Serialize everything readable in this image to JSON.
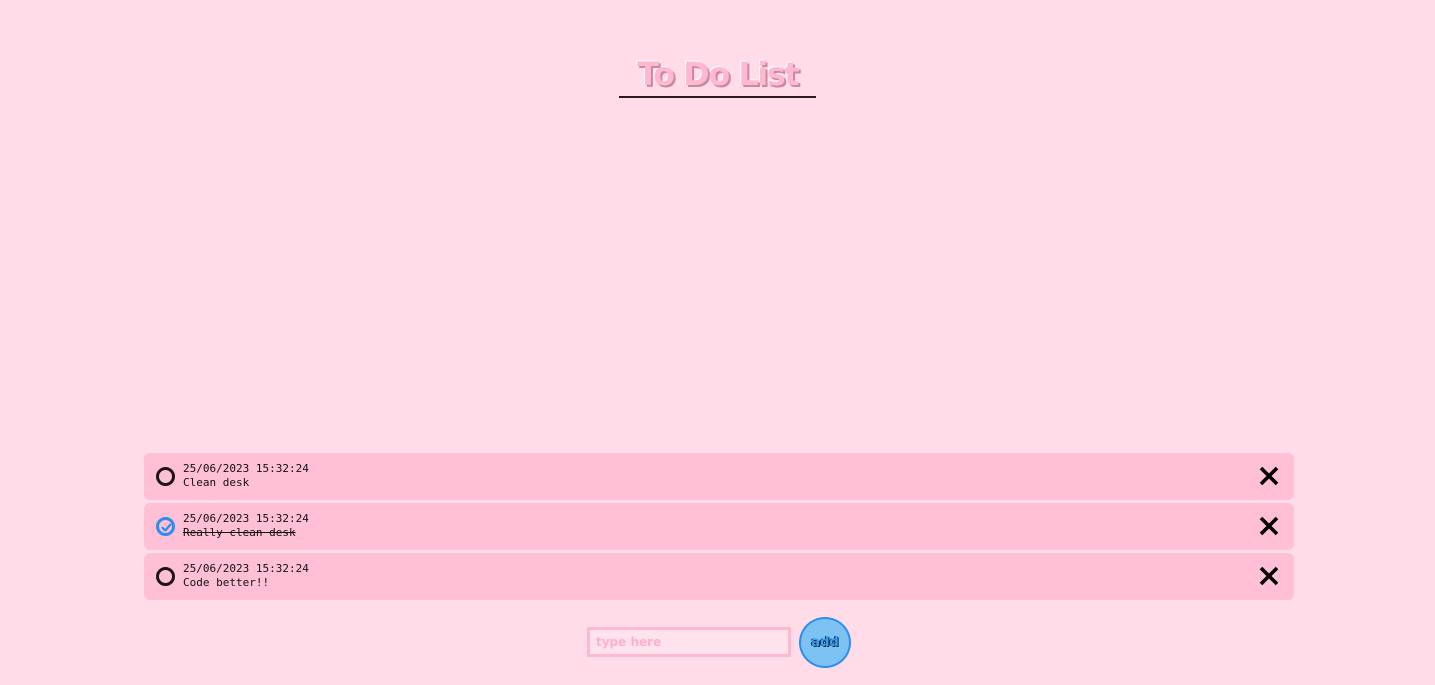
{
  "title": "To Do List",
  "items": [
    {
      "timestamp": "25/06/2023 15:32:24",
      "label": "Clean desk",
      "done": false
    },
    {
      "timestamp": "25/06/2023 15:32:24",
      "label": "Really clean desk",
      "done": true
    },
    {
      "timestamp": "25/06/2023 15:32:24",
      "label": "Code better!!",
      "done": false
    }
  ],
  "input": {
    "placeholder": "type here",
    "value": ""
  },
  "add_button": {
    "label": "add"
  },
  "colors": {
    "background": "#ffdce7",
    "item_background": "#ffbfd5",
    "accent": "#2a8ef0",
    "title": "#ffb8cf"
  },
  "icons": {
    "check": "check-circle-icon",
    "unchecked": "circle-icon",
    "delete": "close-icon"
  }
}
